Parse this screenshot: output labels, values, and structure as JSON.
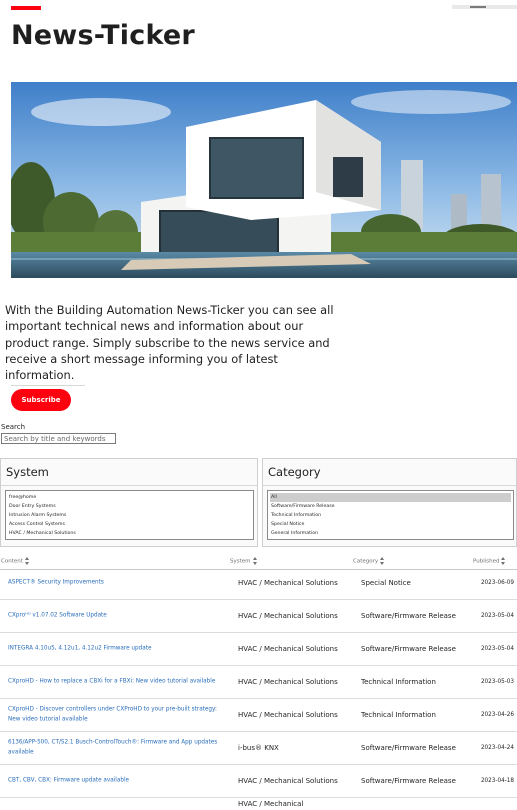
{
  "page": {
    "title": "News-Ticker"
  },
  "hero": {
    "alt": ""
  },
  "intro": {
    "text": "With the Building Automation News-Ticker you can see all important technical news and information about our product range. Simply subscribe to the news service and receive a short message informing you of latest information."
  },
  "subscribe": {
    "label": "Subscribe"
  },
  "search": {
    "label": "Search",
    "placeholder": "Search by title and keywords"
  },
  "filters": {
    "system": {
      "title": "System",
      "options": [
        "free@home",
        "Door Entry Systems",
        "Intrusion Alarm Systems",
        "Access Control Systems",
        "HVAC / Mechanical Solutions"
      ]
    },
    "category": {
      "title": "Category",
      "selected": "All",
      "options": [
        "All",
        "Software/Firmware Release",
        "Technical Information",
        "Special Notice",
        "General Information"
      ]
    }
  },
  "table": {
    "headers": {
      "content": "Content",
      "system": "System",
      "category": "Category",
      "published": "Published"
    },
    "rows": [
      {
        "content": "ASPECT® Security Improvements",
        "system": "HVAC / Mechanical Solutions",
        "category": "Special Notice",
        "published": "2023-06-09"
      },
      {
        "content": "CXproᴴᴰ v1.07.02 Software Update",
        "system": "HVAC / Mechanical Solutions",
        "category": "Software/Firmware Release",
        "published": "2023-05-04"
      },
      {
        "content": "INTEGRA 4.10u5, 4.12u1, 4.12u2 Firmware update",
        "system": "HVAC / Mechanical Solutions",
        "category": "Software/Firmware Release",
        "published": "2023-05-04"
      },
      {
        "content": "CXproHD - How to replace a CBXi for a FBXi: New video tutorial available",
        "system": "HVAC / Mechanical Solutions",
        "category": "Technical Information",
        "published": "2023-05-03"
      },
      {
        "content": "CXproHD - Discover controllers under CXProHD to your pre-built strategy: New video tutorial available",
        "system": "HVAC / Mechanical Solutions",
        "category": "Technical Information",
        "published": "2023-04-26"
      },
      {
        "content": "6136/APP-500, CT/S2.1 Busch-ControlTouch®: Firmware and App updates available",
        "system": "i-bus® KNX",
        "category": "Software/Firmware Release",
        "published": "2023-04-24"
      },
      {
        "content": "CBT, CBV, CBX: Firmware update available",
        "system": "HVAC / Mechanical Solutions",
        "category": "Software/Firmware Release",
        "published": "2023-04-18"
      }
    ],
    "partial_row": {
      "system": "HVAC / Mechanical"
    }
  }
}
